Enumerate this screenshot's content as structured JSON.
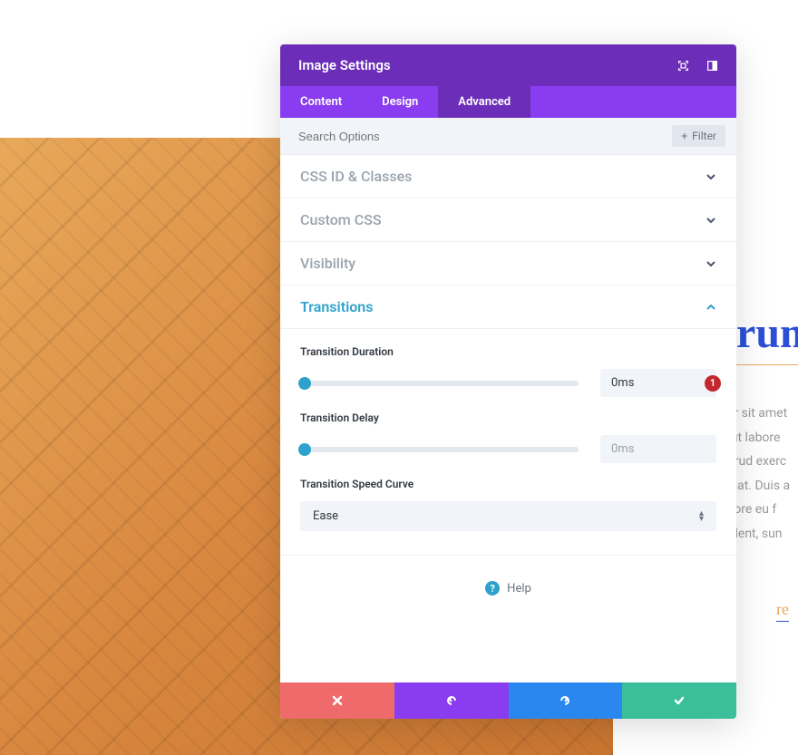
{
  "modal": {
    "title": "Image Settings",
    "tabs": {
      "content": "Content",
      "design": "Design",
      "advanced": "Advanced"
    },
    "search": {
      "placeholder": "Search Options",
      "filter_label": "Filter"
    },
    "sections": {
      "css_id": "CSS ID & Classes",
      "custom_css": "Custom CSS",
      "visibility": "Visibility",
      "transitions": "Transitions"
    },
    "transitions": {
      "duration_label": "Transition Duration",
      "duration_value": "0ms",
      "delay_label": "Transition Delay",
      "delay_value": "0ms",
      "speed_curve_label": "Transition Speed Curve",
      "speed_curve_value": "Ease"
    },
    "help_label": "Help",
    "badge": "1"
  },
  "background": {
    "heading_fragment": "rum",
    "paragraph_lines": [
      "olor sit amet",
      "nt ut labore",
      "ostrud exerc",
      "equat. Duis a",
      " dolore eu f",
      "roident, sun"
    ],
    "link_fragment": "re"
  }
}
